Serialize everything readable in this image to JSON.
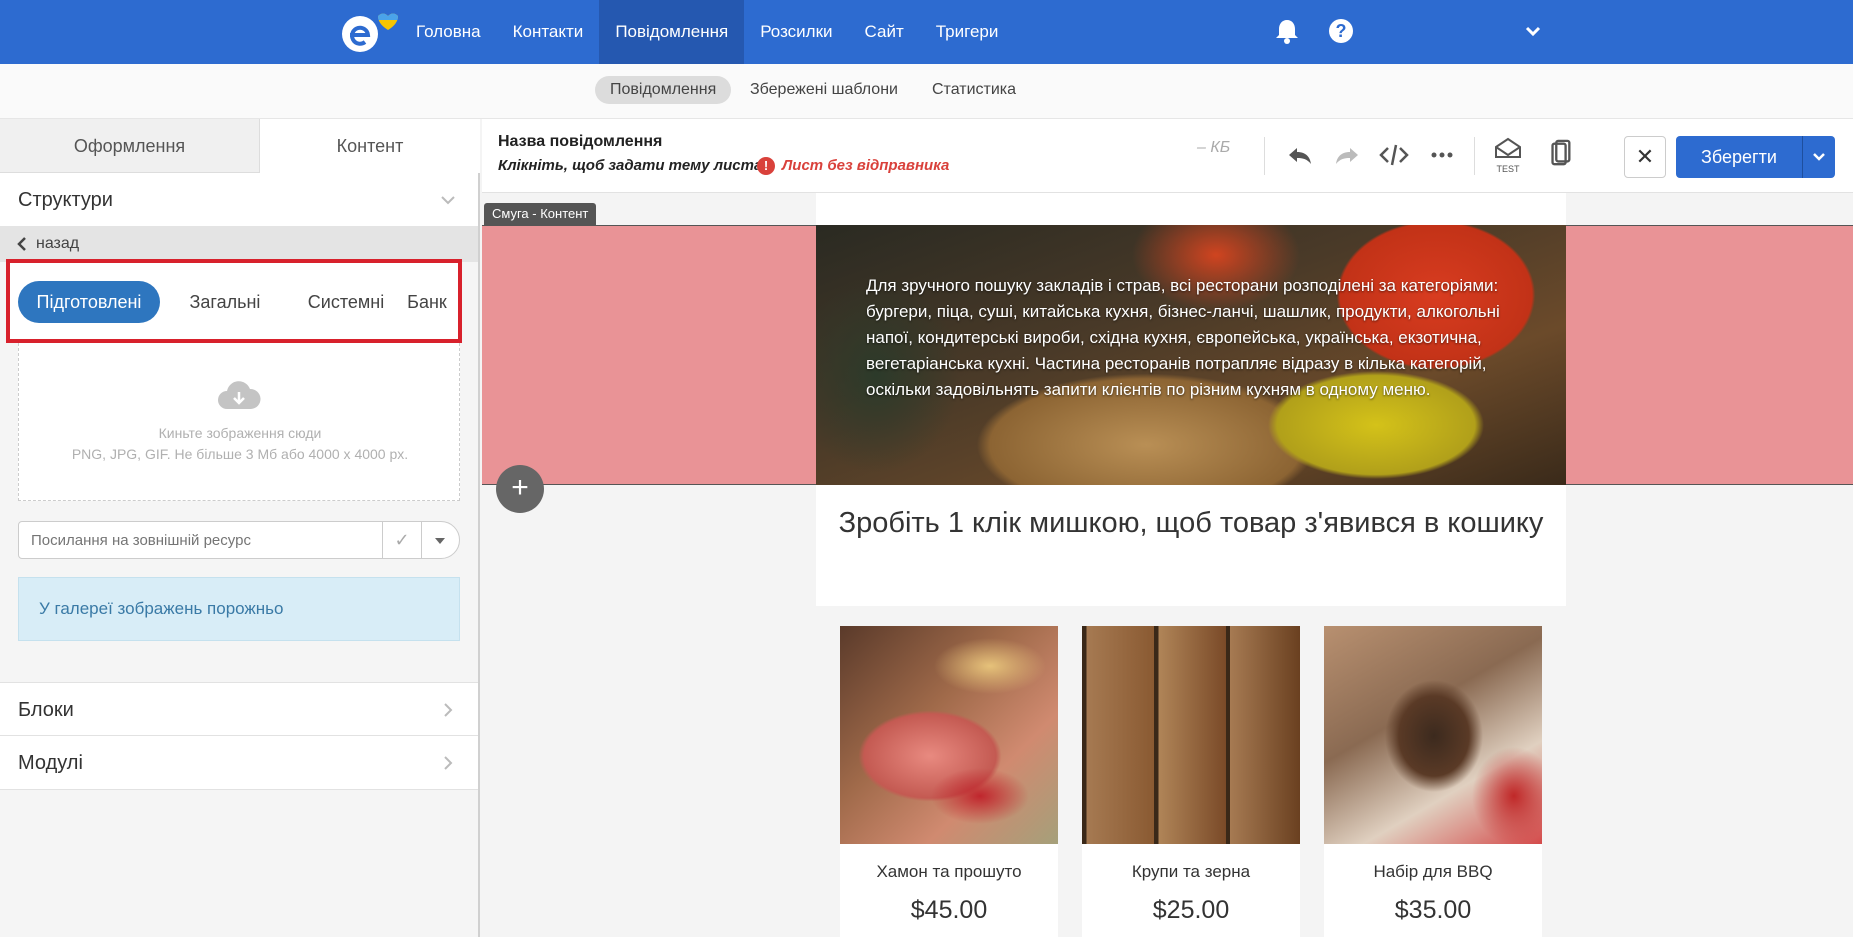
{
  "top_nav": {
    "items": [
      {
        "label": "Головна"
      },
      {
        "label": "Контакти"
      },
      {
        "label": "Повідомлення",
        "active": true
      },
      {
        "label": "Розсилки"
      },
      {
        "label": "Сайт"
      },
      {
        "label": "Тригери"
      }
    ]
  },
  "sub_nav": {
    "items": [
      {
        "label": "Повідомлення",
        "active": true
      },
      {
        "label": "Збережені шаблони"
      },
      {
        "label": "Статистика"
      }
    ]
  },
  "sidebar": {
    "tabs": {
      "design": "Оформлення",
      "content": "Контент"
    },
    "structures_title": "Структури",
    "back_label": "назад",
    "categories": [
      {
        "label": "Підготовлені",
        "active": true
      },
      {
        "label": "Загальні"
      },
      {
        "label": "Системні"
      },
      {
        "label": "Банк"
      }
    ],
    "dropzone": {
      "line1": "Киньте зображення сюди",
      "line2": "PNG, JPG, GIF. Не більше 3 Мб або 4000 x 4000 px."
    },
    "url_placeholder": "Посилання на зовнішній ресурс",
    "gallery_empty": "У галереї зображень порожньо",
    "blocks_title": "Блоки",
    "modules_title": "Модулі"
  },
  "editor": {
    "message_name": "Назва повідомлення",
    "subject_prompt": "Клікніть, щоб задати тему листа",
    "warning": "Лист без відправника",
    "size": "– КБ",
    "test_label": "TEST",
    "save_label": "Зберегти",
    "strip_label": "Смуга - Контент"
  },
  "email": {
    "hero_text": "Для зручного пошуку закладів і страв, всі ресторани розподілені за категоріями: бургери, піца, суші, китайська кухня, бізнес-ланчі, шашлик, продукти, алкогольні напої, кондитерські вироби, східна кухня, європейська, українська, екзотична, вегетаріанська кухні. Частина ресторанів потрапляє відразу в кілька категорій, оскільки задовільнять запити клієнтів по різним кухням в одному меню.",
    "headline": "Зробіть 1 клік мишкою, щоб товар з'явився в кошику",
    "products": [
      {
        "name": "Хамон та прошуто",
        "price": "$45.00"
      },
      {
        "name": "Крупи та зерна",
        "price": "$25.00"
      },
      {
        "name": "Набір для BBQ",
        "price": "$35.00"
      }
    ]
  },
  "colors": {
    "brand_blue": "#2d6bd0",
    "active_pill": "#2e76bf",
    "strip_pink": "#e99396",
    "warning_red": "#d9413b",
    "highlight_red": "#d8212c"
  }
}
